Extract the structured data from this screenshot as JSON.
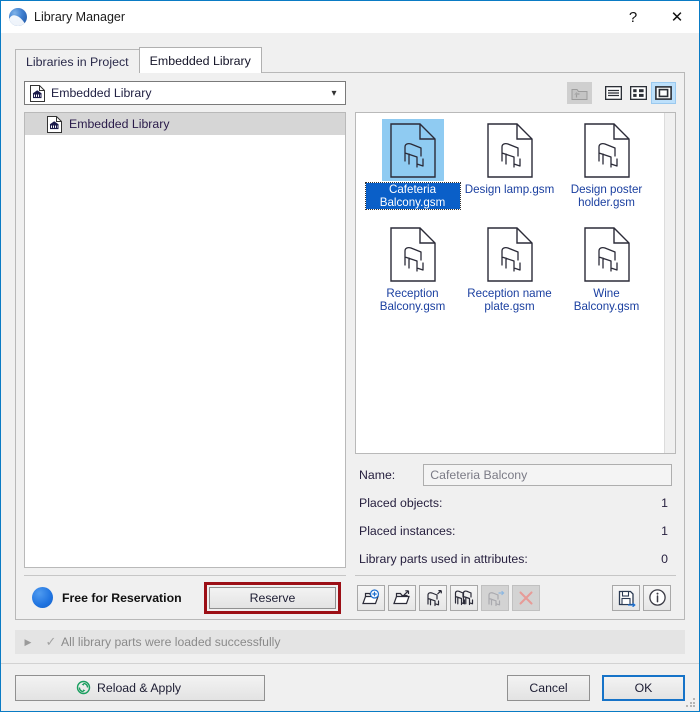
{
  "window": {
    "title": "Library Manager",
    "logo_icon": "archicad-logo-icon",
    "help_label": "?",
    "close_label": "✕"
  },
  "tabs": [
    {
      "label": "Libraries in Project",
      "active": false
    },
    {
      "label": "Embedded Library",
      "active": true
    }
  ],
  "left": {
    "combo": {
      "value": "Embedded Library",
      "icon": "embedded-library-document-icon",
      "chevron_icon": "chevron-down-icon"
    },
    "tree": [
      {
        "label": "Embedded Library",
        "icon": "embedded-library-document-icon",
        "selected": true
      }
    ],
    "reservation": {
      "status_label": "Free for Reservation",
      "status_dot_color": "#1f73e0",
      "button_label": "Reserve",
      "highlight_color": "#9c0f16"
    }
  },
  "view_toolbar": {
    "buttons": [
      {
        "name": "go-up-folder-button",
        "icon": "folder-up-icon",
        "state": "disabled"
      },
      {
        "name": "list-view-button",
        "icon": "list-view-icon",
        "state": "normal"
      },
      {
        "name": "details-view-button",
        "icon": "grid-view-icon",
        "state": "normal"
      },
      {
        "name": "large-icon-view-button",
        "icon": "large-icon-view-icon",
        "state": "selected"
      }
    ]
  },
  "files": [
    {
      "name": "Cafeteria Balcony.gsm",
      "icon": "library-part-object-icon",
      "selected": true
    },
    {
      "name": "Design lamp.gsm",
      "icon": "library-part-object-icon",
      "selected": false
    },
    {
      "name": "Design poster holder.gsm",
      "icon": "library-part-object-icon",
      "selected": false
    },
    {
      "name": "Reception Balcony.gsm",
      "icon": "library-part-object-icon",
      "selected": false
    },
    {
      "name": "Reception name plate.gsm",
      "icon": "library-part-object-icon",
      "selected": false
    },
    {
      "name": "Wine Balcony.gsm",
      "icon": "library-part-object-icon",
      "selected": false
    }
  ],
  "details": {
    "name_label": "Name:",
    "name_value": "Cafeteria Balcony",
    "rows": [
      {
        "label": "Placed objects:",
        "value": "1"
      },
      {
        "label": "Placed instances:",
        "value": "1"
      },
      {
        "label": "Library parts used in attributes:",
        "value": "0"
      }
    ]
  },
  "action_toolbar": {
    "buttons": [
      {
        "name": "add-library-button",
        "icon": "folder-add-icon",
        "state": "normal"
      },
      {
        "name": "export-library-button",
        "icon": "folder-export-icon",
        "state": "normal"
      },
      {
        "name": "embed-object-button",
        "icon": "object-export-icon",
        "state": "normal"
      },
      {
        "name": "duplicate-object-button",
        "icon": "objects-duplicate-icon",
        "state": "normal"
      },
      {
        "name": "move-object-button",
        "icon": "object-move-icon",
        "state": "disabled"
      },
      {
        "name": "delete-object-button",
        "icon": "delete-cross-icon",
        "state": "disabled"
      },
      {
        "name": "save-as-button",
        "icon": "save-as-floppy-icon",
        "state": "normal"
      },
      {
        "name": "info-button",
        "icon": "info-circle-icon",
        "state": "normal"
      }
    ]
  },
  "statusbar": {
    "expand_icon": "triangle-right-icon",
    "check_icon": "check-icon",
    "message": "All library parts were loaded successfully"
  },
  "footer": {
    "reload_label": "Reload & Apply",
    "reload_icon": "refresh-circle-icon",
    "cancel_label": "Cancel",
    "ok_label": "OK",
    "default_accent": "#1673c8"
  }
}
